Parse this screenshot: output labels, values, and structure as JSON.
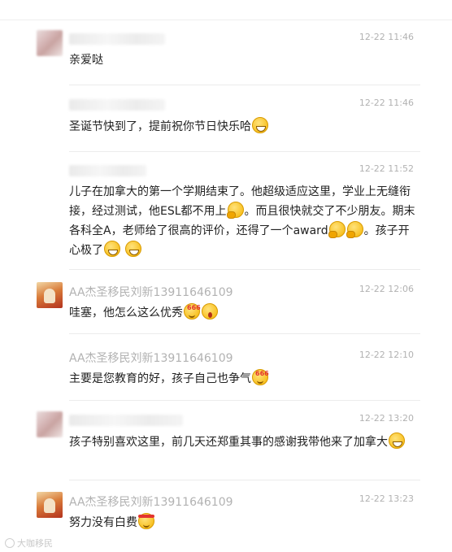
{
  "messages": [
    {
      "avatar": "blurred-avatar",
      "sender_name": "",
      "time": "12-22 11:46",
      "text_parts": [
        {
          "t": "亲爱哒"
        }
      ]
    },
    {
      "avatar": "none",
      "sender_name": "",
      "time": "12-22 11:46",
      "text_parts": [
        {
          "t": "圣诞节快到了，提前祝你节日快乐哈"
        },
        {
          "emoji": "grin-emoji"
        }
      ]
    },
    {
      "avatar": "none",
      "sender_name": "",
      "time": "12-22 11:52",
      "text_parts": [
        {
          "t": "儿子在加拿大的第一个学期结束了。他超级适应这里，学业上无缝衔接，经过测试，他ESL都不用上"
        },
        {
          "emoji": "thinking-emoji"
        },
        {
          "t": "。而且很快就交了不少朋友。期末各科全A，老师给了很高的评价，还得了一个award"
        },
        {
          "emoji": "thinking-emoji"
        },
        {
          "emoji": "thinking-emoji"
        },
        {
          "t": "。孩子开心极了"
        },
        {
          "emoji": "grin-emoji"
        },
        {
          "t": " "
        },
        {
          "emoji": "grin-emoji"
        }
      ]
    },
    {
      "avatar": "agent-avatar",
      "sender_name": "AA杰圣移民刘新13911646109",
      "time": "12-22 12:06",
      "text_parts": [
        {
          "t": "哇塞，他怎么这么优秀"
        },
        {
          "emoji": "666-emoji"
        },
        {
          "emoji": "shocked-emoji"
        }
      ]
    },
    {
      "avatar": "none",
      "sender_name": "AA杰圣移民刘新13911646109",
      "time": "12-22 12:10",
      "text_parts": [
        {
          "t": "主要是您教育的好，孩子自己也争气"
        },
        {
          "emoji": "666-emoji"
        }
      ]
    },
    {
      "avatar": "blurred-avatar",
      "sender_name": "",
      "time": "12-22 13:20",
      "text_parts": [
        {
          "t": "孩子特别喜欢这里，前几天还郑重其事的感谢我带他来了加拿大"
        },
        {
          "emoji": "grin-emoji"
        }
      ]
    },
    {
      "avatar": "agent-avatar",
      "sender_name": "AA杰圣移民刘新13911646109",
      "time": "12-22 13:23",
      "text_parts": [
        {
          "t": "努力没有白费"
        },
        {
          "emoji": "strive-emoji"
        }
      ]
    }
  ],
  "watermark": {
    "text": "大咖移民"
  }
}
